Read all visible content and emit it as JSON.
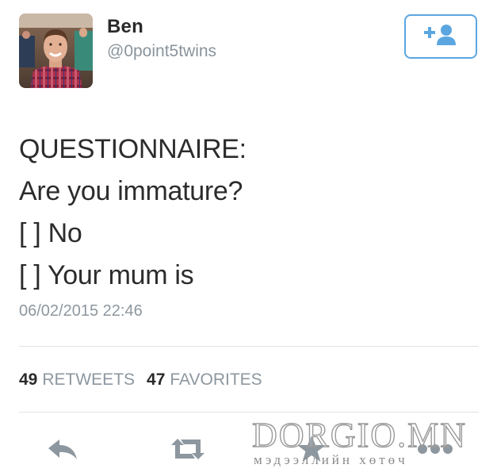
{
  "user": {
    "name": "Ben",
    "handle": "@0point5twins"
  },
  "follow_button": {
    "icon": "follow-user-icon"
  },
  "tweet": {
    "lines": [
      "QUESTIONNAIRE:",
      "Are you immature?",
      "[ ] No",
      "[ ] Your mum is"
    ],
    "timestamp": "06/02/2015 22:46"
  },
  "stats": {
    "retweets_count": "49",
    "retweets_label": "RETWEETS",
    "favorites_count": "47",
    "favorites_label": "FAVORITES"
  },
  "actions": [
    {
      "icon": "reply-icon"
    },
    {
      "icon": "retweet-icon"
    },
    {
      "icon": "favorite-star-icon"
    },
    {
      "icon": "more-icon"
    }
  ],
  "colors": {
    "accent": "#5ba6e0",
    "icon_gray": "#8d979f",
    "text": "#2c2c2c"
  },
  "watermark": {
    "main": "DORGIO.MN",
    "sub": "мэдээллийн хөтөч"
  }
}
